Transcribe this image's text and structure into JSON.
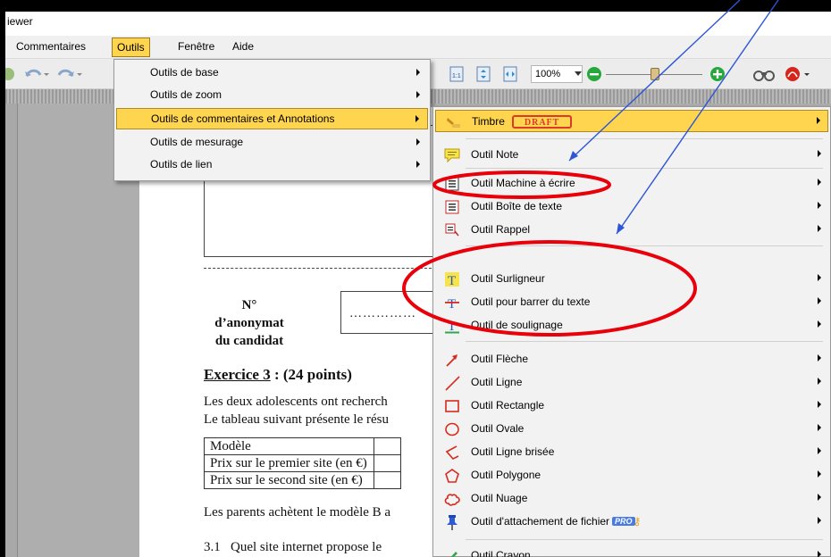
{
  "window": {
    "title": "iewer"
  },
  "menubar": {
    "items": [
      "Commentaires",
      "Outils",
      "Fenêtre",
      "Aide"
    ],
    "active": "Outils"
  },
  "toolbar": {
    "zoom": "100%"
  },
  "tools_menu": {
    "items": [
      "Outils de base",
      "Outils de zoom",
      "Outils de commentaires et Annotations",
      "Outils de mesurage",
      "Outils de lien"
    ]
  },
  "annotations_menu": {
    "stamp": {
      "label": "Timbre",
      "badge": "DRAFT"
    },
    "items": [
      {
        "label": "Outil Note",
        "icon": "note-icon"
      },
      {
        "label": "Outil Machine à écrire",
        "icon": "typewriter-icon"
      },
      {
        "label": "Outil Boîte de texte",
        "icon": "textbox-icon"
      },
      {
        "label": "Outil Rappel",
        "icon": "callout-icon"
      },
      {
        "label": "Outil Surligneur",
        "icon": "highlighter-icon"
      },
      {
        "label": "Outil pour barrer du texte",
        "icon": "strikeout-icon"
      },
      {
        "label": "Outil de soulignage",
        "icon": "underline-icon"
      },
      {
        "label": "Outil Flèche",
        "icon": "arrow-tool-icon"
      },
      {
        "label": "Outil Ligne",
        "icon": "line-tool-icon"
      },
      {
        "label": "Outil Rectangle",
        "icon": "rectangle-tool-icon"
      },
      {
        "label": "Outil Ovale",
        "icon": "oval-tool-icon"
      },
      {
        "label": "Outil Ligne brisée",
        "icon": "polyline-tool-icon"
      },
      {
        "label": "Outil Polygone",
        "icon": "polygon-tool-icon"
      },
      {
        "label": "Outil Nuage",
        "icon": "cloud-tool-icon"
      },
      {
        "label": "Outil d'attachement de fichier",
        "icon": "pushpin-icon",
        "badge": "PRO"
      },
      {
        "label": "Outil Crayon",
        "icon": "pencil-icon"
      }
    ]
  },
  "document": {
    "anonymat_line1": "N° d’anonymat",
    "anonymat_line2": "du candidat",
    "anonymat_dots": "……………",
    "exercise_label": "Exercice 3",
    "exercise_points": " : (24 points)",
    "paragraph1": "Les deux adolescents ont recherch",
    "paragraph2": "Le tableau suivant présente le résu",
    "table": [
      "Modèle",
      "Prix sur le premier site (en €)",
      "Prix sur le second site (en €)"
    ],
    "paragraph3": "Les parents achètent le modèle B a",
    "question_number": "3.1",
    "question_text": "Quel site internet propose le"
  },
  "colors": {
    "menu_highlight": "#ffd54f",
    "annotation_red": "#e8000b",
    "arrow_blue": "#2d55d6"
  }
}
